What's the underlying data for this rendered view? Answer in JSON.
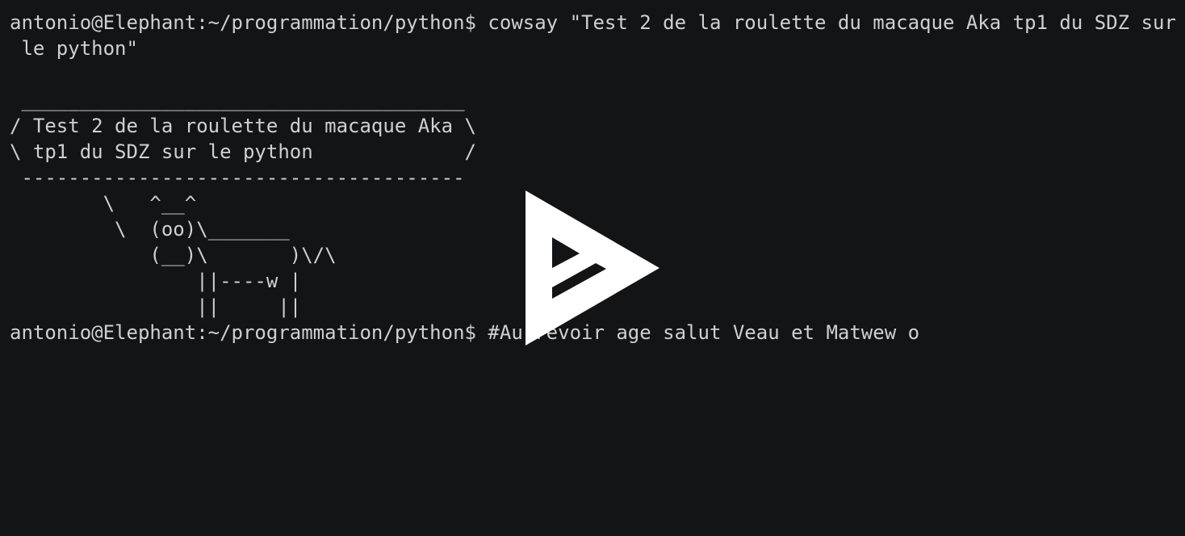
{
  "terminal": {
    "lines": [
      "antonio@Elephant:~/programmation/python$ cowsay \"Test 2 de la roulette du macaque Aka tp1 du SDZ sur",
      " le python\"",
      "",
      " ______________________________________",
      "/ Test 2 de la roulette du macaque Aka \\",
      "\\ tp1 du SDZ sur le python             /",
      " --------------------------------------",
      "        \\   ^__^",
      "         \\  (oo)\\_______",
      "            (__)\\       )\\/\\",
      "                ||----w |",
      "                ||     ||",
      "antonio@Elephant:~/programmation/python$ #Au revoir age salut Veau et Matwew o"
    ]
  },
  "overlay": {
    "icon": "asciinema-play-icon",
    "color": "#ffffff"
  },
  "colors": {
    "background": "#131416",
    "foreground": "#cfd0d2"
  }
}
